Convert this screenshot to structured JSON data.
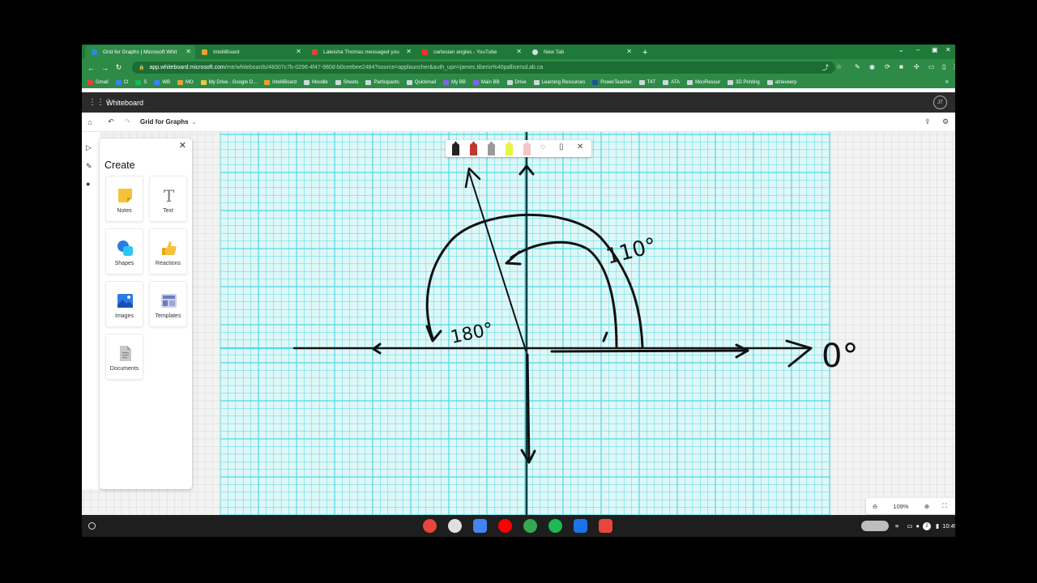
{
  "browser": {
    "tabs": [
      {
        "label": "Grid for Graphs | Microsoft Whit",
        "active": true,
        "favicon_color": "#2a8cd6",
        "favicon": "whiteboard-icon"
      },
      {
        "label": "IntelliBoard",
        "active": false,
        "favicon_color": "#f0a02a",
        "favicon": "intelliboard-icon"
      },
      {
        "label": "Lateisha Thomas messaged you",
        "active": false,
        "favicon_color": "#e0443a",
        "favicon": "gmail-icon"
      },
      {
        "label": "cartesian angles - YouTube",
        "active": false,
        "favicon_color": "#ff2a2a",
        "favicon": "youtube-icon"
      },
      {
        "label": "New Tab",
        "active": false,
        "favicon_color": "#dddddd",
        "favicon": "chrome-icon"
      }
    ],
    "url_host": "app.whiteboard.microsoft.com",
    "url_path": "/me/whiteboards/48307c7b-0296-4f47-980d-b0ceebee2484?source=applauncher&auth_upn=james.tiberio%40pallisersd.ab.ca",
    "bookmarks": [
      {
        "label": "Gmail",
        "color": "#e0443a"
      },
      {
        "label": "Cl",
        "color": "#3b82f6"
      },
      {
        "label": "S",
        "color": "#1db954"
      },
      {
        "label": "WB",
        "color": "#3b82f6"
      },
      {
        "label": "MO",
        "color": "#e6a33a"
      },
      {
        "label": "My Drive - Google D...",
        "color": "#f4c542"
      },
      {
        "label": "IntelliBoard",
        "color": "#f0a02a"
      },
      {
        "label": "Moodle",
        "color": "#cfd8dc"
      },
      {
        "label": "Sheets",
        "color": "#cfd8dc"
      },
      {
        "label": "Participants",
        "color": "#cfd8dc"
      },
      {
        "label": "Quickmail",
        "color": "#cfd8dc"
      },
      {
        "label": "My BB",
        "color": "#8a5cf6"
      },
      {
        "label": "Main BB",
        "color": "#8a5cf6"
      },
      {
        "label": "Drive",
        "color": "#cfd8dc"
      },
      {
        "label": "Learning Resources",
        "color": "#cfd8dc"
      },
      {
        "label": "PowerTeacher",
        "color": "#1e4fa3"
      },
      {
        "label": "T4T",
        "color": "#cfd8dc"
      },
      {
        "label": "ATA",
        "color": "#cfd8dc"
      },
      {
        "label": "MooResour",
        "color": "#cfd8dc"
      },
      {
        "label": "3D Printing",
        "color": "#cfd8dc"
      },
      {
        "label": "atrieveerp",
        "color": "#cfd8dc"
      }
    ]
  },
  "app": {
    "title": "Whiteboard",
    "avatar_initials": "JT",
    "board_name": "Grid for Graphs"
  },
  "create_panel": {
    "title": "Create",
    "items": [
      {
        "label": "Notes",
        "icon": "notes-icon"
      },
      {
        "label": "Text",
        "icon": "text-icon"
      },
      {
        "label": "Shapes",
        "icon": "shapes-icon"
      },
      {
        "label": "Reactions",
        "icon": "reactions-icon"
      },
      {
        "label": "Images",
        "icon": "images-icon"
      },
      {
        "label": "Templates",
        "icon": "templates-icon"
      },
      {
        "label": "Documents",
        "icon": "documents-icon"
      }
    ]
  },
  "canvas": {
    "annotations": {
      "label_110": "110°",
      "label_180": "180°",
      "label_0": "0°"
    },
    "grid_color": "#4fd9e0",
    "ink_color": "#111111"
  },
  "ink_toolbar": {
    "pens": [
      {
        "name": "black-pen",
        "color": "#222222"
      },
      {
        "name": "red-pen",
        "color": "#c0392b"
      },
      {
        "name": "gray-pen",
        "color": "#9a9a9a"
      },
      {
        "name": "highlighter",
        "color": "#e6f542"
      },
      {
        "name": "eraser",
        "color": "#f2c6c6"
      }
    ]
  },
  "zoom": {
    "level": "109%"
  },
  "shelf": {
    "time": "10:45",
    "notification_count": "2",
    "apps": [
      {
        "name": "chrome-app",
        "color": "#e8453c"
      },
      {
        "name": "gmail-app",
        "color": "#e0e0e0"
      },
      {
        "name": "docs-app",
        "color": "#4285f4"
      },
      {
        "name": "youtube-app",
        "color": "#ff0000"
      },
      {
        "name": "play-store-app",
        "color": "#34a853"
      },
      {
        "name": "spotify-app",
        "color": "#1db954"
      },
      {
        "name": "files-app",
        "color": "#1a73e8"
      },
      {
        "name": "screencast-app",
        "color": "#e8453c"
      }
    ]
  }
}
